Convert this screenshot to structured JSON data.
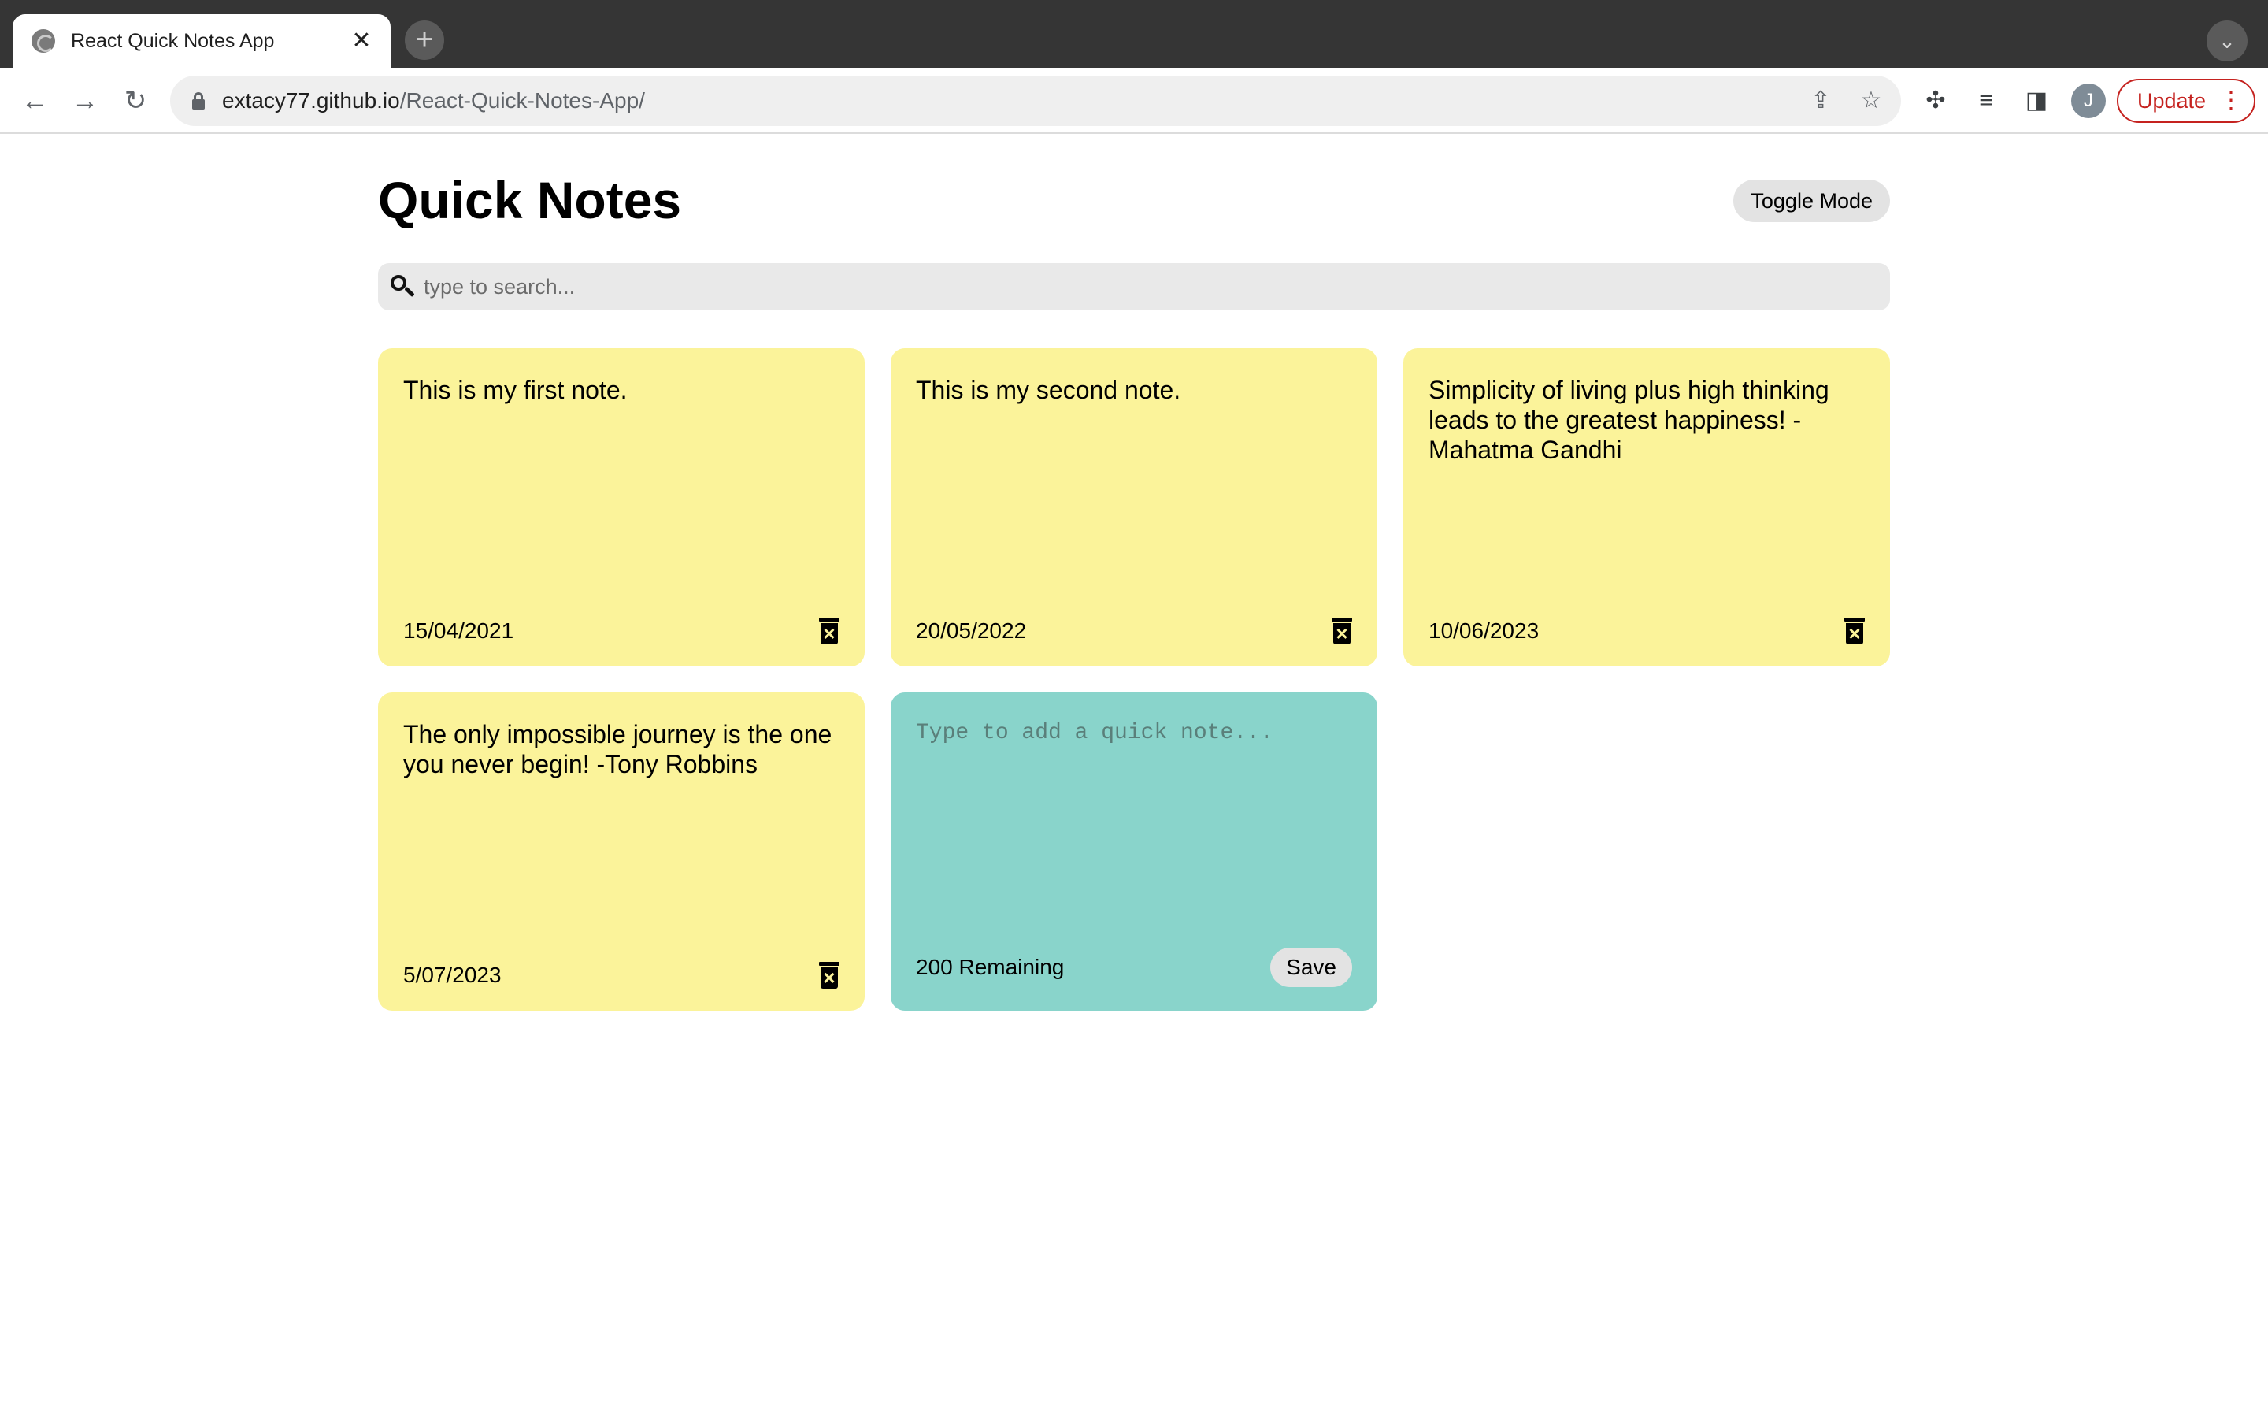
{
  "browser": {
    "tab_title": "React Quick Notes App",
    "tab_close": "✕",
    "new_tab": "+",
    "url_host": "extacy77.github.io",
    "url_path": "/React-Quick-Notes-App/",
    "avatar_letter": "J",
    "update_label": "Update",
    "icons": [
      "back-arrow-icon",
      "forward-arrow-icon",
      "reload-icon",
      "lock-icon",
      "share-icon",
      "star-icon",
      "extensions-icon",
      "reading-list-icon",
      "side-panel-icon",
      "tab-search-icon"
    ]
  },
  "app": {
    "title": "Quick Notes",
    "toggle_label": "Toggle Mode",
    "search_placeholder": "type to search...",
    "notes": [
      {
        "text": "This is my first note.",
        "date": "15/04/2021"
      },
      {
        "text": "This is my second note.",
        "date": "20/05/2022"
      },
      {
        "text": "Simplicity of living plus high thinking leads to the greatest happiness! - Mahatma Gandhi",
        "date": "10/06/2023"
      },
      {
        "text": "The only impossible journey is the one you never begin! -Tony Robbins",
        "date": "5/07/2023"
      }
    ],
    "new_note": {
      "placeholder": "Type to add a quick note...",
      "remaining": "200 Remaining",
      "save_label": "Save"
    }
  },
  "colors": {
    "note_yellow": "#fbf39a",
    "new_note_teal": "#89d4cb",
    "search_bg": "#e9e9e9",
    "button_grey": "#e3e3e3"
  }
}
